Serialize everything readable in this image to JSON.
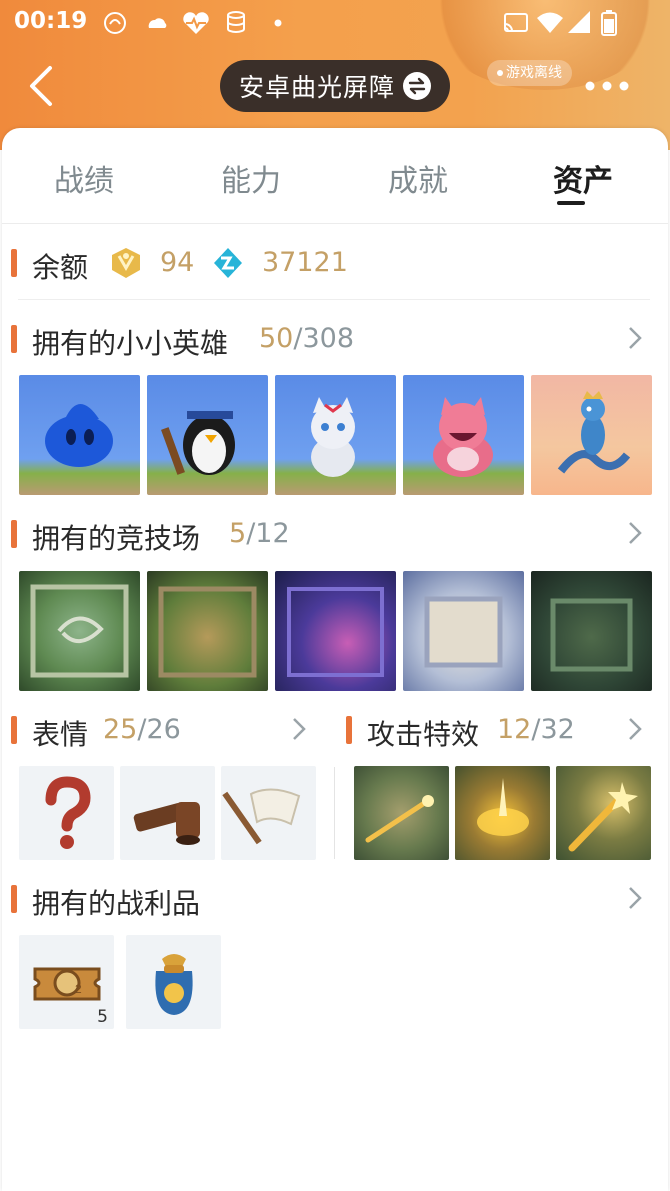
{
  "status_bar": {
    "time": "00:19"
  },
  "header": {
    "title": "安卓曲光屏障",
    "offline_label": "游戏离线"
  },
  "tabs": [
    {
      "label": "战绩",
      "active": false
    },
    {
      "label": "能力",
      "active": false
    },
    {
      "label": "成就",
      "active": false
    },
    {
      "label": "资产",
      "active": true
    }
  ],
  "balance": {
    "label": "余额",
    "coin": "94",
    "gem": "37121"
  },
  "legends": {
    "title": "拥有的小小英雄",
    "owned": "50",
    "total": "/308"
  },
  "arenas": {
    "title": "拥有的竞技场",
    "owned": "5",
    "total": "/12"
  },
  "emotes": {
    "title": "表情",
    "owned": "25",
    "total": "/26"
  },
  "attack_effects": {
    "title": "攻击特效",
    "owned": "12",
    "total": "/32"
  },
  "loot": {
    "title": "拥有的战利品",
    "items": [
      {
        "name": "ticket-icon",
        "count": "5"
      },
      {
        "name": "loot-bag-icon",
        "count": ""
      }
    ]
  },
  "colors": {
    "accent": "#e8733a",
    "gold": "#c4a066",
    "header_orange": "#f08a3c"
  }
}
